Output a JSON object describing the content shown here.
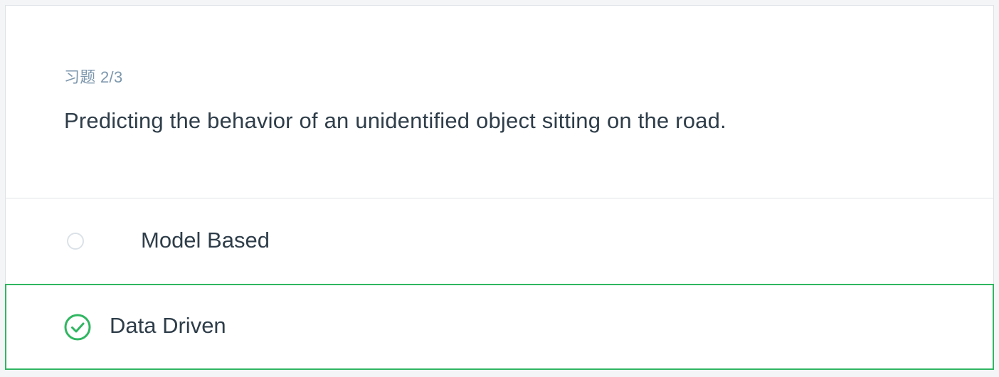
{
  "quiz": {
    "counter": "习题 2/3",
    "question": "Predicting the behavior of an unidentified object sitting on the road.",
    "options": [
      {
        "label": "Model Based",
        "selected": false,
        "icon": "radio-empty-icon"
      },
      {
        "label": "Data Driven",
        "selected": true,
        "icon": "check-circle-icon"
      }
    ],
    "colors": {
      "correct": "#30b661",
      "text": "#2e3d49",
      "muted": "#7d97ad",
      "border": "#dfe2e6"
    }
  }
}
